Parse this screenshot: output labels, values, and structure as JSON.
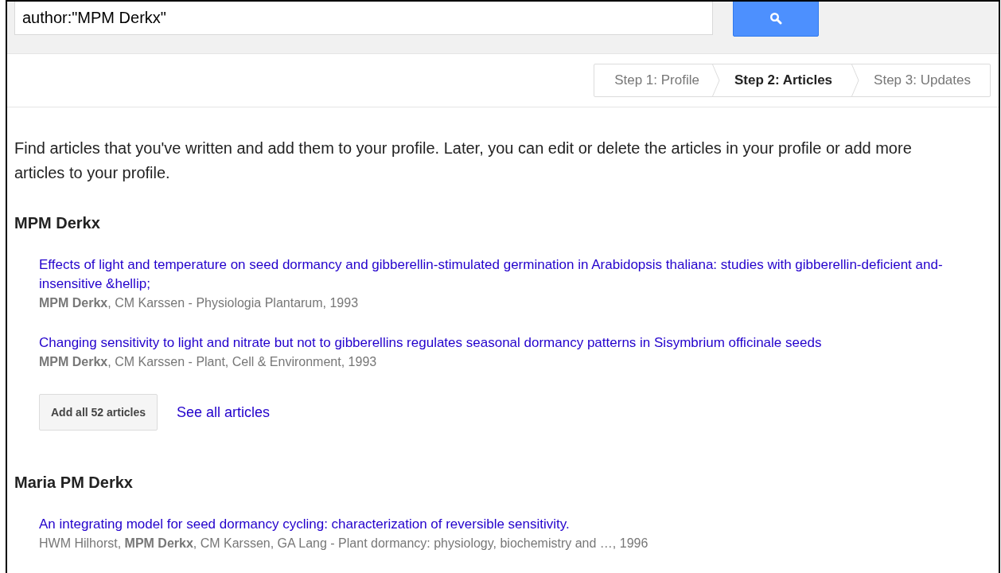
{
  "search": {
    "value": "author:\"MPM Derkx\""
  },
  "steps": [
    {
      "label": "Step 1: Profile",
      "selected": false
    },
    {
      "label": "Step 2: Articles",
      "selected": true
    },
    {
      "label": "Step 3: Updates",
      "selected": false
    }
  ],
  "intro": "Find articles that you've written and add them to your profile. Later, you can edit or delete the articles in your profile or add more articles to your profile.",
  "groups": [
    {
      "name": "MPM Derkx",
      "articles": [
        {
          "title": "Effects of light and temperature on seed dormancy and gibberellin-stimulated germination in Arabidopsis thaliana: studies with gibberellin-deficient and-insensitive &hellip;",
          "meta": "**MPM Derkx**, CM Karssen - Physiologia Plantarum, 1993"
        },
        {
          "title": "Changing sensitivity to light and nitrate but not to gibberellins regulates seasonal dormancy patterns in Sisymbrium officinale seeds",
          "meta": "**MPM Derkx**, CM Karssen - Plant, Cell & Environment, 1993"
        }
      ],
      "add_button": "Add all 52 articles",
      "see_all": "See all articles"
    },
    {
      "name": "Maria PM Derkx",
      "articles": [
        {
          "title": "An integrating model for seed dormancy cycling: characterization of reversible sensitivity.",
          "meta": "HWM Hilhorst, **MPM Derkx**, CM Karssen, GA Lang - Plant dormancy: physiology, biochemistry and …, 1996"
        }
      ]
    }
  ]
}
